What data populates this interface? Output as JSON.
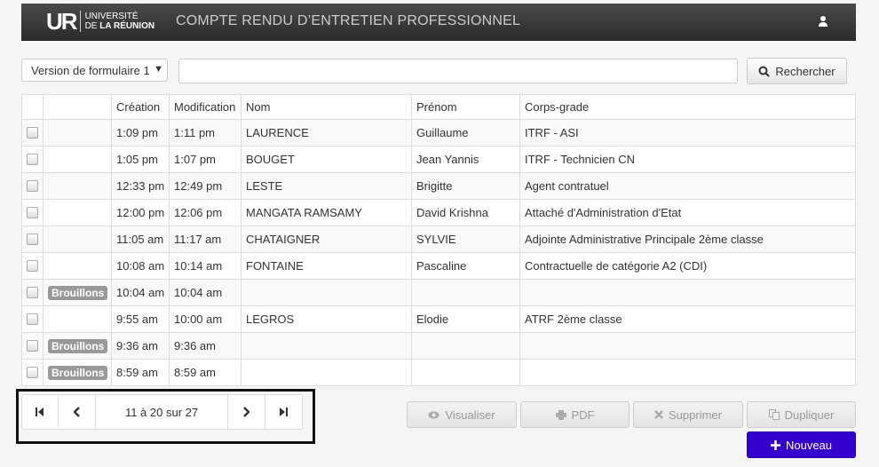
{
  "header": {
    "logo_mark": "UR",
    "logo_line1": "UNIVERSITÉ",
    "logo_line2_prefix": "DE ",
    "logo_line2_bold": "LA RÉUNION",
    "title": "COMPTE RENDU D’ENTRETIEN PROFESSIONNEL",
    "user_icon": "user-icon"
  },
  "toolbar": {
    "form_version": "Version de formulaire 1",
    "search_value": "",
    "search_label": "Rechercher"
  },
  "table": {
    "columns": [
      "",
      "",
      "Création",
      "Modification",
      "Nom",
      "Prénom",
      "Corps-grade"
    ],
    "rows": [
      {
        "badge": "",
        "creation": "1:09 pm",
        "modification": "1:11 pm",
        "nom": "LAURENCE",
        "prenom": "Guillaume",
        "corps": "ITRF - ASI"
      },
      {
        "badge": "",
        "creation": "1:05 pm",
        "modification": "1:07 pm",
        "nom": "BOUGET",
        "prenom": "Jean Yannis",
        "corps": "ITRF - Technicien CN"
      },
      {
        "badge": "",
        "creation": "12:33 pm",
        "modification": "12:49 pm",
        "nom": "LESTE",
        "prenom": "Brigitte",
        "corps": "Agent contratuel"
      },
      {
        "badge": "",
        "creation": "12:00 pm",
        "modification": "12:06 pm",
        "nom": "MANGATA RAMSAMY",
        "prenom": "David Krishna",
        "corps": "Attaché d'Administration d'Etat"
      },
      {
        "badge": "",
        "creation": "11:05 am",
        "modification": "11:17 am",
        "nom": "CHATAIGNER",
        "prenom": "SYLVIE",
        "corps": "Adjointe Administrative Principale 2ème classe"
      },
      {
        "badge": "",
        "creation": "10:08 am",
        "modification": "10:14 am",
        "nom": "FONTAINE",
        "prenom": "Pascaline",
        "corps": "Contractuelle de catégorie A2 (CDI)"
      },
      {
        "badge": "Brouillons",
        "creation": "10:04 am",
        "modification": "10:04 am",
        "nom": "",
        "prenom": "",
        "corps": ""
      },
      {
        "badge": "",
        "creation": "9:55 am",
        "modification": "10:00 am",
        "nom": "LEGROS",
        "prenom": "Elodie",
        "corps": "ATRF 2ème classe"
      },
      {
        "badge": "Brouillons",
        "creation": "9:36 am",
        "modification": "9:36 am",
        "nom": "",
        "prenom": "",
        "corps": ""
      },
      {
        "badge": "Brouillons",
        "creation": "8:59 am",
        "modification": "8:59 am",
        "nom": "",
        "prenom": "",
        "corps": ""
      }
    ]
  },
  "pager": {
    "range": "11 à 20 sur 27"
  },
  "actions": {
    "view": "Visualiser",
    "pdf": "PDF",
    "delete": "Supprimer",
    "duplicate": "Dupliquer",
    "new": "Nouveau"
  },
  "colors": {
    "header_bg": "#2b2b2b",
    "new_button": "#3300cc",
    "badge_bg": "#999999"
  }
}
